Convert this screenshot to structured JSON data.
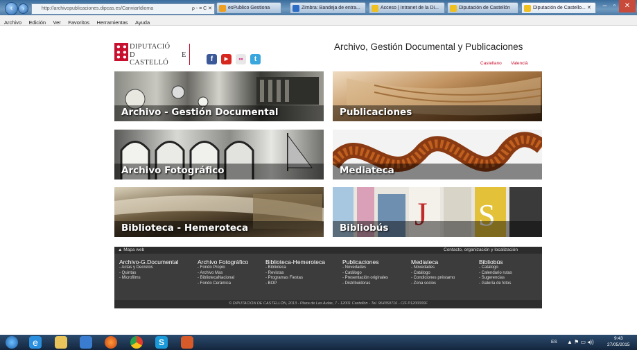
{
  "browser": {
    "url": "http://archivopublicaciones.dipcas.es/CanviarIdioma",
    "address_controls": "ρ - ≡ C ✕",
    "tabs": [
      {
        "label": "esPublico Gestiona"
      },
      {
        "label": "Zimbra: Bandeja de entra..."
      },
      {
        "label": "Acceso | Intranet de la Di..."
      },
      {
        "label": "Diputación de Castellón"
      },
      {
        "label": "Diputación de Castello... ✕"
      }
    ],
    "menu": [
      "Archivo",
      "Edición",
      "Ver",
      "Favoritos",
      "Herramientas",
      "Ayuda"
    ]
  },
  "header": {
    "org_line1": "DIPUTACIÓ",
    "org_line2a": "D",
    "org_line2b": "E",
    "org_line3": "CASTELLÓ",
    "site_title": "Archivo, Gestión Documental y Publicaciones",
    "lang_castellano": "Castellano",
    "lang_valencia": "Valencià",
    "social": [
      {
        "icon": "facebook-icon",
        "glyph": "f",
        "color": "#3b5998"
      },
      {
        "icon": "youtube-icon",
        "glyph": "▶",
        "color": "#d6281f"
      },
      {
        "icon": "flickr-icon",
        "glyph": "••",
        "color": "#e8e8e8"
      },
      {
        "icon": "twitter-icon",
        "glyph": "t",
        "color": "#39a6dd"
      }
    ]
  },
  "tiles": [
    {
      "label": "Archivo - Gestión Documental"
    },
    {
      "label": "Publicaciones"
    },
    {
      "label": "Archivo Fotográfico"
    },
    {
      "label": "Mediateca"
    },
    {
      "label": "Biblioteca - Hemeroteca"
    },
    {
      "label": "Bibliobús"
    }
  ],
  "footer": {
    "sitemap": "▲ Mapa web",
    "contact": "Contacto, organización y localización",
    "columns": [
      {
        "title": "Archivo-G.Documental",
        "items": [
          "- Actas y Decretos",
          "- Quintas",
          "- Microfilms"
        ]
      },
      {
        "title": "Archivo Fotográfico",
        "items": [
          "- Fondo Propio",
          "- Archivo Mas",
          "- BibliotecaNacional",
          "- Fondo Cerámica"
        ]
      },
      {
        "title": "Biblioteca-Hemeroteca",
        "items": [
          "- Biblioteca",
          "- Revistas",
          "- Programas Fiestas",
          "- BOP"
        ]
      },
      {
        "title": "Publicaciones",
        "items": [
          "- Novedades",
          "- Catálogo",
          "- Presentación originales",
          "- Distribuidoras"
        ]
      },
      {
        "title": "Mediateca",
        "items": [
          "- Novedades",
          "- Catálogo",
          "- Condiciones préstamo",
          "- Zona socios"
        ]
      },
      {
        "title": "Bibliobús",
        "items": [
          "- Catálogo",
          "- Calendario rutas",
          "- Sugerencias",
          "- Galería de fotos"
        ]
      }
    ],
    "copyright": "© DIPUTACIÓN DE CASTELLÓN, 2013 - Plaza de Las Aulas, 7 - 12001 Castellón - Tel. 964359716 - CIF P1200000F"
  },
  "taskbar": {
    "lang": "ES",
    "time": "9:43",
    "date": "27/05/2015"
  }
}
